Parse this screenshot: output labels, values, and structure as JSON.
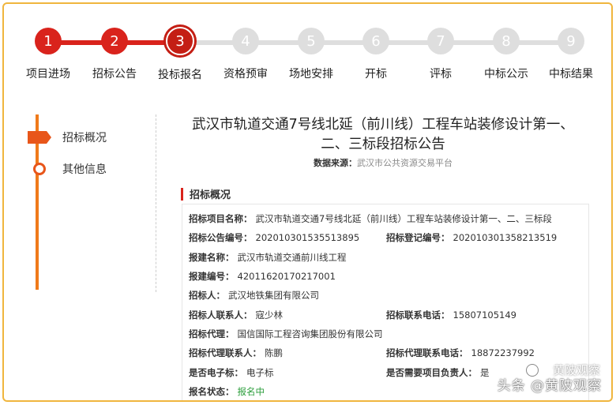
{
  "steps": [
    {
      "num": "1",
      "label": "项目进场",
      "state": "done"
    },
    {
      "num": "2",
      "label": "招标公告",
      "state": "done"
    },
    {
      "num": "3",
      "label": "投标报名",
      "state": "current"
    },
    {
      "num": "4",
      "label": "资格预审",
      "state": "todo"
    },
    {
      "num": "5",
      "label": "场地安排",
      "state": "todo"
    },
    {
      "num": "6",
      "label": "开标",
      "state": "todo"
    },
    {
      "num": "7",
      "label": "评标",
      "state": "todo"
    },
    {
      "num": "8",
      "label": "中标公示",
      "state": "todo"
    },
    {
      "num": "9",
      "label": "中标结果",
      "state": "todo"
    }
  ],
  "nav": {
    "item1": "招标概况",
    "item2": "其他信息"
  },
  "notice": {
    "title_line1": "武汉市轨道交通7号线北延（前川线）工程车站装修设计第一、",
    "title_line2": "二、三标段招标公告",
    "source_label": "数据来源：",
    "source_value": "武汉市公共资源交易平台",
    "section_title": "招标概况"
  },
  "fields": {
    "project_name_k": "招标项目名称：",
    "project_name_v": "武汉市轨道交通7号线北延（前川线）工程车站装修设计第一、二、三标段",
    "notice_no_k": "招标公告编号：",
    "notice_no_v": "202010301535513895",
    "reg_no_k": "招标登记编号：",
    "reg_no_v": "202010301358213519",
    "build_name_k": "报建名称：",
    "build_name_v": "武汉市轨道交通前川线工程",
    "build_no_k": "报建编号：",
    "build_no_v": "42011620170217001",
    "tenderer_k": "招标人：",
    "tenderer_v": "武汉地铁集团有限公司",
    "contact_k": "招标人联系人：",
    "contact_v": "寇少林",
    "phone_k": "招标联系电话：",
    "phone_v": "15807105149",
    "agent_k": "招标代理：",
    "agent_v": "国信国际工程咨询集团股份有限公司",
    "agent_contact_k": "招标代理联系人：",
    "agent_contact_v": "陈鹏",
    "agent_phone_k": "招标代理联系电话：",
    "agent_phone_v": "18872237992",
    "electronic_k": "是否电子标：",
    "electronic_v": "电子标",
    "manager_k": "是否需要项目负责人：",
    "manager_v": "是",
    "status_k": "报名状态：",
    "status_v": "报名中"
  },
  "watermark": {
    "line1": "黄陂观察",
    "line2": "头条 @黄陂观察"
  },
  "colors": {
    "accent_red": "#d9231c",
    "nav_orange": "#e8561a",
    "frame": "#f0b63e",
    "status_green": "#2a9d3a"
  }
}
